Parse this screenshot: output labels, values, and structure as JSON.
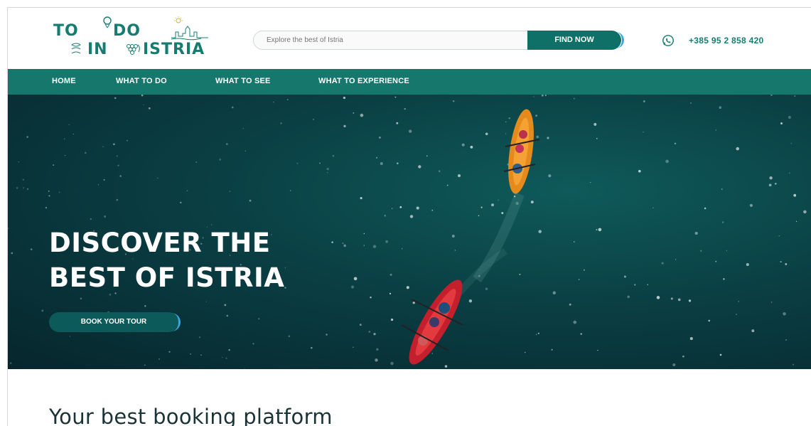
{
  "brand": {
    "logo_line1_a": "TO",
    "logo_line1_b": "DO",
    "logo_line2_a": "IN",
    "logo_line2_b": "ISTRIA"
  },
  "search": {
    "placeholder": "Explore the best of Istria",
    "button_label": "FIND NOW"
  },
  "contact": {
    "phone": "+385 95 2 858 420",
    "icon": "whatsapp-icon"
  },
  "nav": {
    "items": [
      {
        "label": "HOME"
      },
      {
        "label": "WHAT TO DO"
      },
      {
        "label": "WHAT TO SEE"
      },
      {
        "label": "WHAT TO EXPERIENCE"
      }
    ]
  },
  "hero": {
    "title_line1": "DISCOVER THE",
    "title_line2": "BEST OF ISTRIA",
    "cta_label": "BOOK YOUR TOUR"
  },
  "section": {
    "title": "Your best booking platform"
  },
  "colors": {
    "brand_green": "#16786d",
    "button_green": "#0e7066",
    "accent_blue": "#3aa6d6",
    "sea_dark": "#06262c"
  }
}
